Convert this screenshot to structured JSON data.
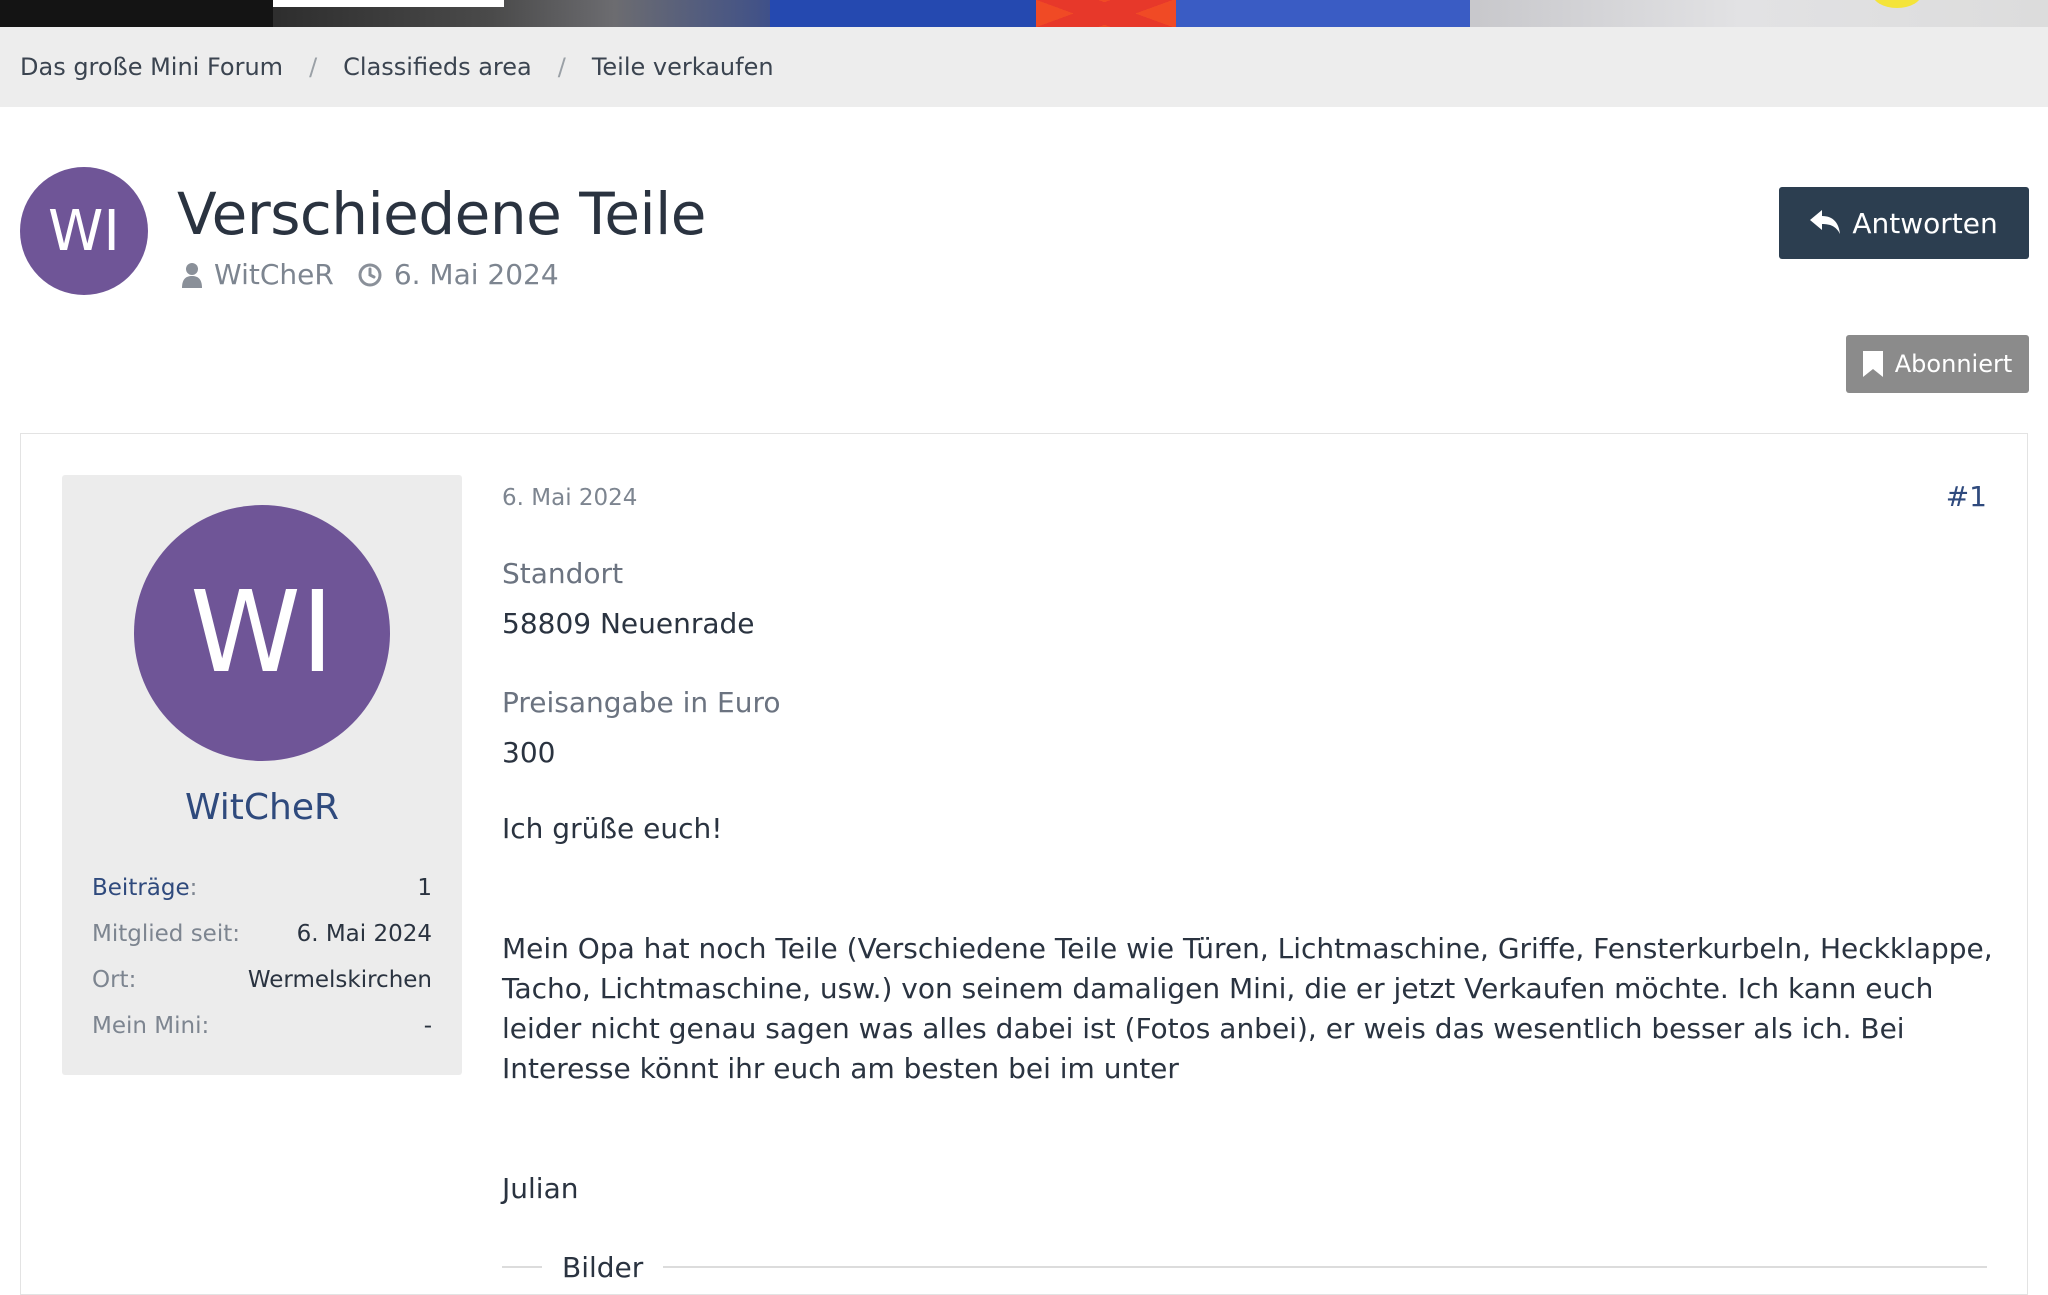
{
  "breadcrumb": {
    "items": [
      "Das große Mini Forum",
      "Classifieds area",
      "Teile verkaufen"
    ],
    "separator": "/"
  },
  "thread": {
    "avatar_initials": "WI",
    "title": "Verschiedene Teile",
    "author": "WitCheR",
    "date": "6. Mai 2024",
    "reply_label": "Antworten",
    "subscribed_label": "Abonniert"
  },
  "user": {
    "avatar_initials": "WI",
    "name": "WitCheR",
    "stats": [
      {
        "label": "Beiträge",
        "suffix": ":",
        "value": "1"
      },
      {
        "label": "Mitglied seit:",
        "suffix": "",
        "value": "6. Mai 2024"
      },
      {
        "label": "Ort:",
        "suffix": "",
        "value": "Wermelskirchen"
      },
      {
        "label": "Mein Mini:",
        "suffix": "",
        "value": "-"
      }
    ]
  },
  "post": {
    "date": "6. Mai 2024",
    "permalink": "#1",
    "location_label": "Standort",
    "location_value": "58809 Neuenrade",
    "price_label": "Preisangabe in Euro",
    "price_value": "300",
    "greeting": "Ich grüße euch!",
    "body": "Mein Opa hat noch Teile (Verschiedene Teile wie Türen, Lichtmaschine, Griffe, Fensterkurbeln, Heckklappe, Tacho, Lichtmaschine, usw.) von seinem damaligen Mini, die er jetzt Verkaufen möchte. Ich kann euch leider nicht genau sagen was alles dabei ist (Fotos anbei), er weis das wesentlich besser als ich. Bei Interesse könnt ihr euch am besten bei im unter",
    "signature": "Julian",
    "attachments_label": "Bilder"
  },
  "colors": {
    "avatar": "#6f5597",
    "reply_button": "#2c3e50",
    "subscribed_button": "#8b8b8b",
    "link": "#2f4a7d"
  }
}
